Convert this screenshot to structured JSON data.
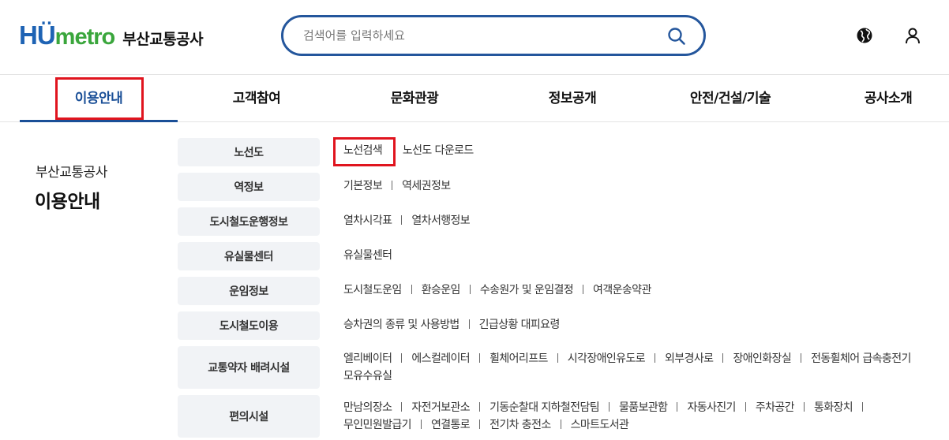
{
  "header": {
    "logo_hu": "HÜ",
    "logo_metro": "metro",
    "logo_name": "부산교통공사",
    "search_placeholder": "검색어를 입력하세요",
    "icons": {
      "search": "search-icon",
      "globe": "globe-icon",
      "user": "user-icon"
    },
    "accent_color": "#24569c"
  },
  "gnb": {
    "items": [
      {
        "label": "이용안내",
        "active": true
      },
      {
        "label": "고객참여"
      },
      {
        "label": "문화관광"
      },
      {
        "label": "정보공개"
      },
      {
        "label": "안전/건설/기술"
      },
      {
        "label": "공사소개"
      }
    ],
    "highlight_color": "#e0141e"
  },
  "side": {
    "subtitle": "부산교통공사",
    "title": "이용안내"
  },
  "menu": [
    {
      "head": "노선도",
      "links": [
        "노선검색",
        "노선도 다운로드"
      ]
    },
    {
      "head": "역정보",
      "links": [
        "기본정보",
        "역세권정보"
      ]
    },
    {
      "head": "도시철도운행정보",
      "links": [
        "열차시각표",
        "열차서행정보"
      ]
    },
    {
      "head": "유실물센터",
      "links": [
        "유실물센터"
      ]
    },
    {
      "head": "운임정보",
      "links": [
        "도시철도운임",
        "환승운임",
        "수송원가 및 운임결정",
        "여객운송약관"
      ]
    },
    {
      "head": "도시철도이용",
      "links": [
        "승차권의 종류 및 사용방법",
        "긴급상황 대피요령"
      ]
    },
    {
      "head": "교통약자 배려시설",
      "links": [
        "엘리베이터",
        "에스컬레이터",
        "휠체어리프트",
        "시각장애인유도로",
        "외부경사로",
        "장애인화장실",
        "전동휠체어 급속충전기",
        "모유수유실"
      ]
    },
    {
      "head": "편의시설",
      "links": [
        "만남의장소",
        "자전거보관소",
        "기동순찰대 지하철전담팀",
        "물품보관함",
        "자동사진기",
        "주차공간",
        "통화장치",
        "무인민원발급기",
        "연결통로",
        "전기차 충전소",
        "스마트도서관"
      ]
    }
  ]
}
